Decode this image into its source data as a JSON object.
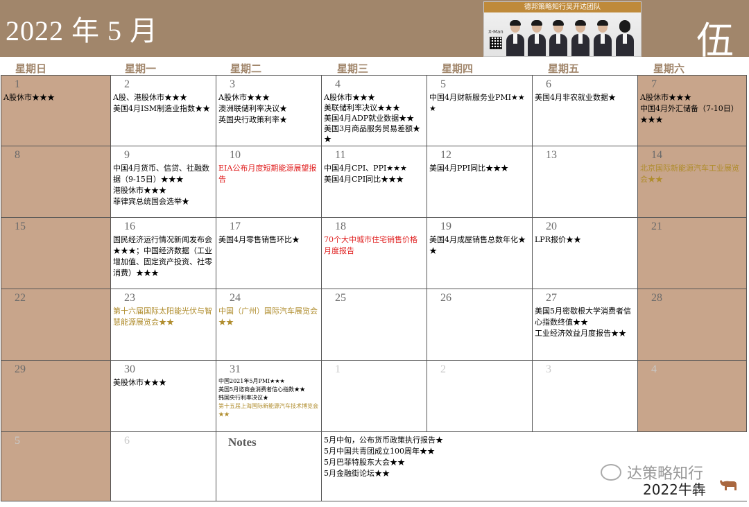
{
  "header": {
    "title": "2022 年 5 月",
    "big_char": "伍",
    "banner": {
      "top_text": "德邦策略知行吴开达团队",
      "small_text": "X-Man"
    }
  },
  "weekdays": [
    "星期日",
    "星期一",
    "星期二",
    "星期三",
    "星期四",
    "星期五",
    "星期六"
  ],
  "weeks": [
    [
      {
        "day": "1",
        "events": [
          "A股休市★★★"
        ]
      },
      {
        "day": "2",
        "events": [
          "A股、港股休市★★★",
          "美国4月ISM制造业指数★★"
        ]
      },
      {
        "day": "3",
        "events": [
          "A股休市★★★",
          "澳洲联储利率决议★",
          "英国央行政策利率★"
        ]
      },
      {
        "day": "4",
        "events": [
          "A股休市★★★",
          "美联储利率决议★★★",
          "美国4月ADP就业数据★★",
          "美国3月商品服务贸易差额★★"
        ]
      },
      {
        "day": "5",
        "events": [
          "中国4月财新服务业PMI★★★"
        ]
      },
      {
        "day": "6",
        "events": [
          "美国4月非农就业数据★"
        ]
      },
      {
        "day": "7",
        "events": [
          "A股休市★★★",
          "中国4月外汇储备（7-10日）★★★"
        ]
      }
    ],
    [
      {
        "day": "8",
        "events": []
      },
      {
        "day": "9",
        "events": [
          "中国4月货币、信贷、社融数据（9-15日）★★★",
          "港股休市★★★",
          "菲律宾总统国会选举★"
        ]
      },
      {
        "day": "10",
        "events": [
          "EIA公布月度短期能源展望报告"
        ]
      },
      {
        "day": "11",
        "events": [
          "中国4月CPI、PPI★★★",
          "美国4月CPI同比★★★"
        ]
      },
      {
        "day": "12",
        "events": [
          "美国4月PPI同比★★★"
        ]
      },
      {
        "day": "13",
        "events": []
      },
      {
        "day": "14",
        "events": [
          "北京国际新能源汽车工业展览会★★"
        ]
      }
    ],
    [
      {
        "day": "15",
        "events": []
      },
      {
        "day": "16",
        "events": [
          "国民经济运行情况新闻发布会★★★；中国经济数据（工业增加值、固定资产投资、社零消费）★★★"
        ]
      },
      {
        "day": "17",
        "events": [
          "美国4月零售销售环比★"
        ]
      },
      {
        "day": "18",
        "events": [
          "70个大中城市住宅销售价格月度报告"
        ]
      },
      {
        "day": "19",
        "events": [
          "美国4月成屋销售总数年化★★"
        ]
      },
      {
        "day": "20",
        "events": [
          "LPR报价★★"
        ]
      },
      {
        "day": "21",
        "events": []
      }
    ],
    [
      {
        "day": "22",
        "events": []
      },
      {
        "day": "23",
        "events": [
          "第十六届国际太阳能光伏与智慧能源展览会★★"
        ]
      },
      {
        "day": "24",
        "events": [
          "中国（广州）国际汽车展览会★★"
        ]
      },
      {
        "day": "25",
        "events": []
      },
      {
        "day": "26",
        "events": []
      },
      {
        "day": "27",
        "events": [
          "美国5月密歇根大学消费者信心指数终值★★",
          "工业经济效益月度报告★★"
        ]
      },
      {
        "day": "28",
        "events": []
      }
    ],
    [
      {
        "day": "29",
        "events": []
      },
      {
        "day": "30",
        "events": [
          "美股休市★★★"
        ]
      },
      {
        "day": "31",
        "events": [
          "中国2021年5月PMI★★★",
          "美国5月谘商会消费者信心指数★★",
          "韩国央行利率决议★",
          "第十五届上海国际新能源汽车技术博览会★★"
        ]
      },
      {
        "day": "1",
        "events": []
      },
      {
        "day": "2",
        "events": []
      },
      {
        "day": "3",
        "events": []
      },
      {
        "day": "4",
        "events": []
      }
    ]
  ],
  "last_row": {
    "sun": "5",
    "mon": "6",
    "notes_title": "Notes",
    "notes": [
      "5月中旬，公布货币政策执行报告★",
      "5月中国共青团成立100周年★★",
      "5月巴菲特股东大会★★",
      "5月金融街论坛★★"
    ]
  },
  "footer": {
    "brand": "达策略知行",
    "year": "2022牛犇"
  },
  "colors": {
    "header_bg": "#a1866b",
    "weekend_bg": "#c8a58b",
    "red_event": "#e02020",
    "gold_event": "#b08d2e"
  }
}
